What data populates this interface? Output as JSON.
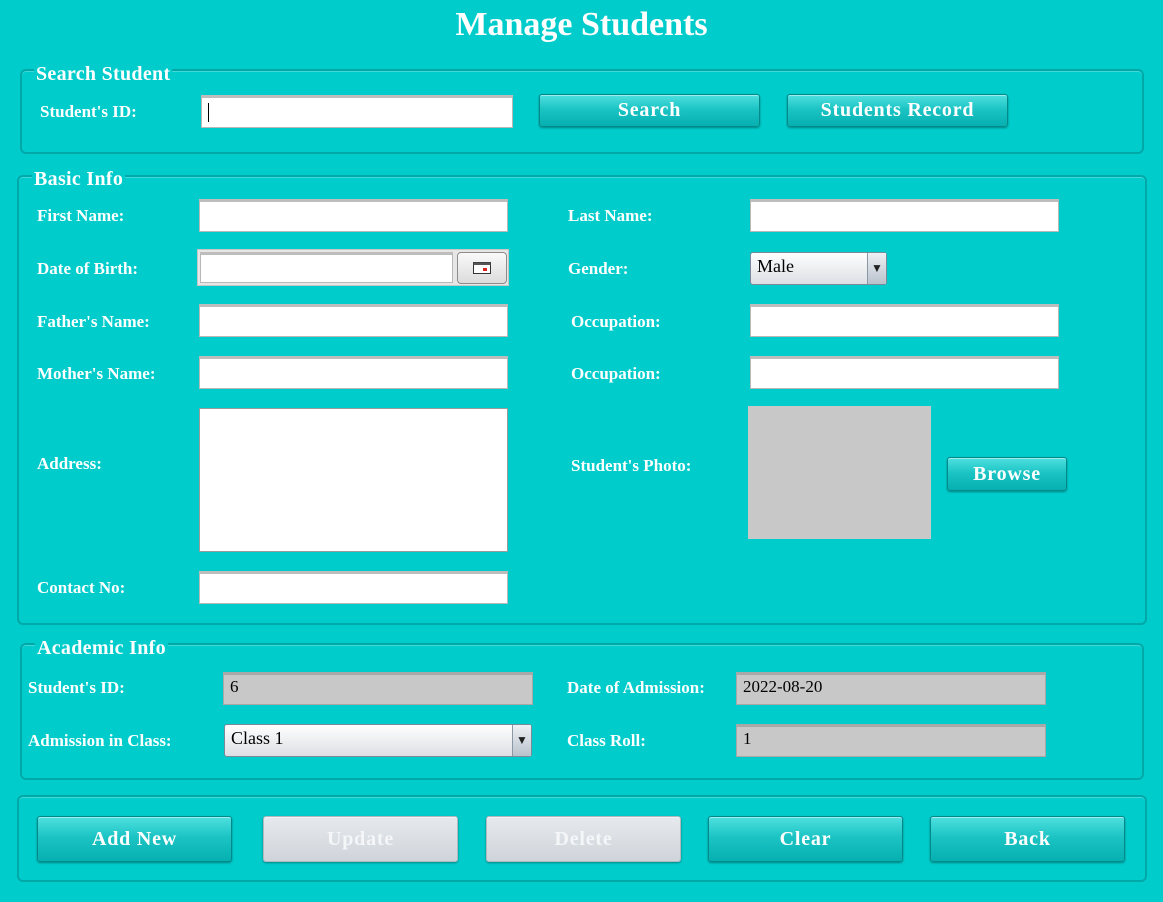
{
  "title": "Manage Students",
  "search": {
    "legend": "Search Student",
    "id_label": "Student's ID:",
    "id_value": "",
    "search_button": "Search",
    "record_button": "Students Record"
  },
  "basic": {
    "legend": "Basic Info",
    "first_name_label": "First Name:",
    "first_name_value": "",
    "last_name_label": "Last Name:",
    "last_name_value": "",
    "dob_label": "Date of Birth:",
    "dob_value": "",
    "gender_label": "Gender:",
    "gender_value": "Male",
    "father_label": "Father's Name:",
    "father_value": "",
    "father_occupation_label": "Occupation:",
    "father_occupation_value": "",
    "mother_label": "Mother's Name:",
    "mother_value": "",
    "mother_occupation_label": "Occupation:",
    "mother_occupation_value": "",
    "address_label": "Address:",
    "address_value": "",
    "photo_label": "Student's Photo:",
    "browse_button": "Browse",
    "contact_label": "Contact No:",
    "contact_value": ""
  },
  "academic": {
    "legend": "Academic Info",
    "id_label": "Student's ID:",
    "id_value": "6",
    "admission_date_label": "Date of Admission:",
    "admission_date_value": "2022-08-20",
    "class_label": "Admission in Class:",
    "class_value": "Class 1",
    "roll_label": "Class Roll:",
    "roll_value": "1"
  },
  "actions": {
    "add_new": "Add New",
    "update": "Update",
    "delete": "Delete",
    "clear": "Clear",
    "back": "Back"
  },
  "colors": {
    "background": "#00cccc",
    "button": "#1cc4c4",
    "readonly_field": "#c8c8c8"
  }
}
